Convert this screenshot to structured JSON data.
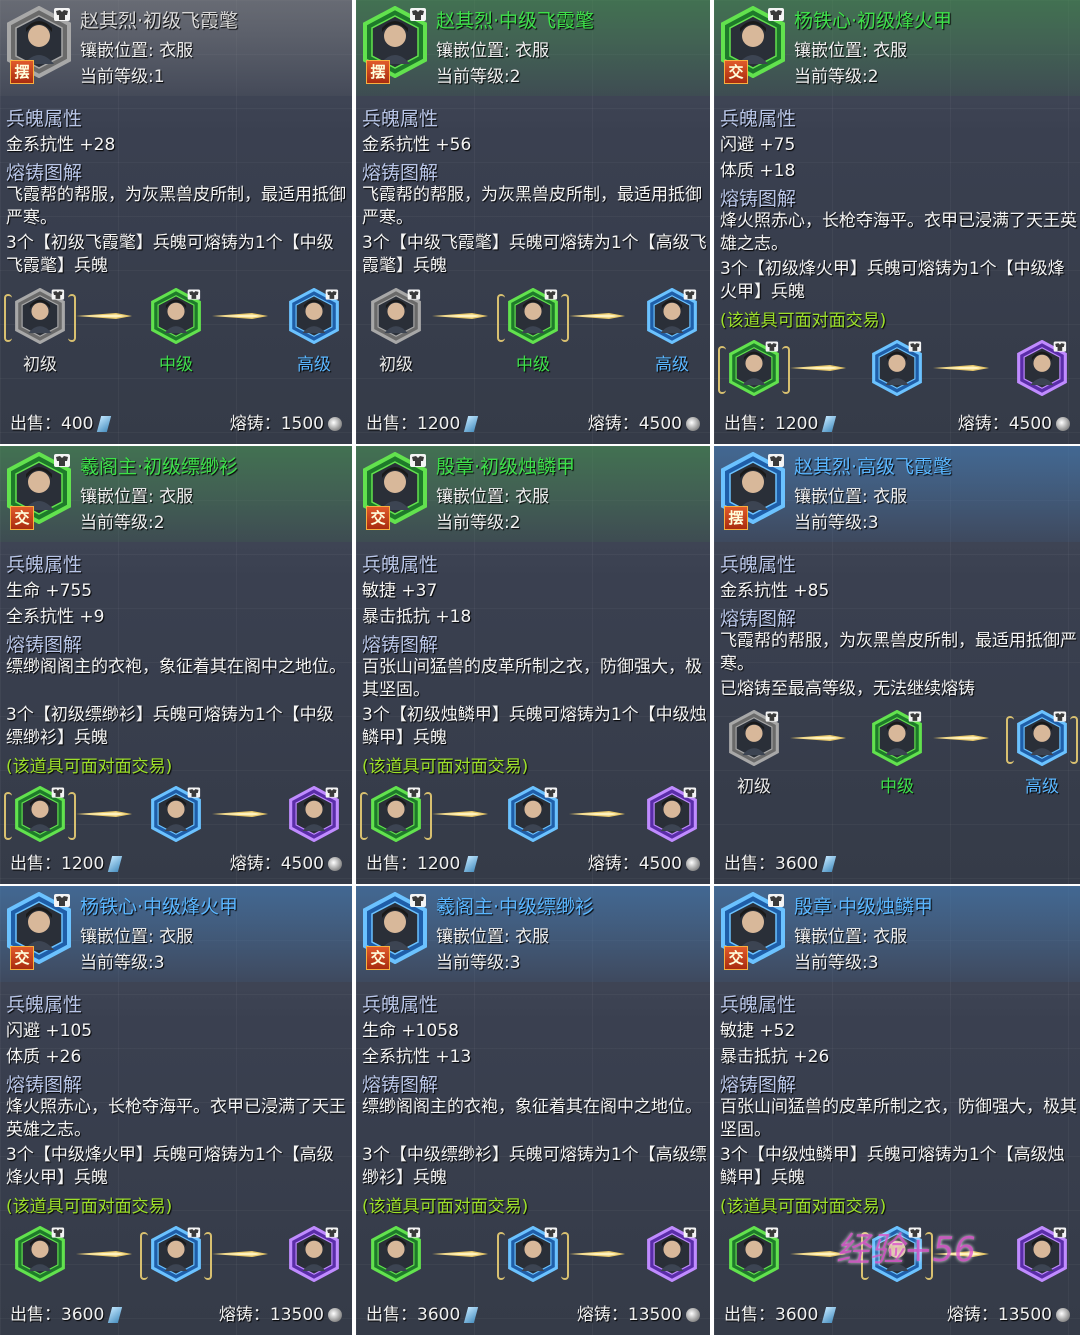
{
  "labels": {
    "slot_prefix": "镶嵌位置:",
    "level_prefix": "当前等级:",
    "attr_header": "兵魄属性",
    "forge_header": "熔铸图解",
    "tier_low": "初级",
    "tier_mid": "中级",
    "tier_high": "高级",
    "sell_prefix": "出售：",
    "forge_prefix": "熔铸：",
    "tradeable_note": "(该道具可面对面交易)"
  },
  "colors": {
    "tier_low": "#d8d8d8",
    "tier_mid": "#3ee04a",
    "tier_high": "#5ab6ff",
    "note": "#9de02a"
  },
  "cards": [
    {
      "badge": "摆",
      "title": "赵其烈·初级飞霞氅",
      "title_color": "gray",
      "slot": "衣服",
      "level": "1",
      "attrs": [
        "金系抗性 +28"
      ],
      "desc": "飞霞帮的帮服，为灰黑兽皮所制，最适用抵御严寒。",
      "forge_text": "3个【初级飞霞氅】兵魄可熔铸为1个【中级飞霞氅】兵魄",
      "note": "",
      "show_labels": true,
      "current": 0,
      "sell": "400",
      "forge": "1500"
    },
    {
      "badge": "摆",
      "title": "赵其烈·中级飞霞氅",
      "title_color": "green",
      "slot": "衣服",
      "level": "2",
      "attrs": [
        "金系抗性 +56"
      ],
      "desc": "飞霞帮的帮服，为灰黑兽皮所制，最适用抵御严寒。",
      "forge_text": "3个【中级飞霞氅】兵魄可熔铸为1个【高级飞霞氅】兵魄",
      "note": "",
      "show_labels": true,
      "current": 1,
      "sell": "1200",
      "forge": "4500"
    },
    {
      "badge": "交",
      "title": "杨铁心·初级烽火甲",
      "title_color": "green",
      "slot": "衣服",
      "level": "2",
      "attrs": [
        "闪避 +75",
        "体质 +18"
      ],
      "desc": "烽火照赤心，长枪夺海平。衣甲已浸满了天王英雄之志。",
      "forge_text": "3个【初级烽火甲】兵魄可熔铸为1个【中级烽火甲】兵魄",
      "note": "(该道具可面对面交易)",
      "show_labels": false,
      "current": 0,
      "sell": "1200",
      "forge": "4500"
    },
    {
      "badge": "交",
      "title": "羲阁主·初级缥缈衫",
      "title_color": "green",
      "slot": "衣服",
      "level": "2",
      "attrs": [
        "生命 +755",
        "全系抗性 +9"
      ],
      "desc": "缥缈阁阁主的衣袍，象征着其在阁中之地位。",
      "forge_text": "3个【初级缥缈衫】兵魄可熔铸为1个【中级缥缈衫】兵魄",
      "note": "(该道具可面对面交易)",
      "show_labels": false,
      "current": 0,
      "sell": "1200",
      "forge": "4500"
    },
    {
      "badge": "交",
      "title": "殷章·初级烛鳞甲",
      "title_color": "green",
      "slot": "衣服",
      "level": "2",
      "attrs": [
        "敏捷 +37",
        "暴击抵抗 +18"
      ],
      "desc": "百张山间猛兽的皮革所制之衣，防御强大，极其坚固。",
      "forge_text": "3个【初级烛鳞甲】兵魄可熔铸为1个【中级烛鳞甲】兵魄",
      "note": "(该道具可面对面交易)",
      "show_labels": false,
      "current": 0,
      "sell": "1200",
      "forge": "4500"
    },
    {
      "badge": "摆",
      "title": "赵其烈·高级飞霞氅",
      "title_color": "blue",
      "slot": "衣服",
      "level": "3",
      "attrs": [
        "金系抗性 +85"
      ],
      "desc": "飞霞帮的帮服，为灰黑兽皮所制，最适用抵御严寒。",
      "forge_text": "已熔铸至最高等级，无法继续熔铸",
      "note": "",
      "show_labels": true,
      "current": 2,
      "sell": "3600",
      "forge": ""
    },
    {
      "badge": "交",
      "title": "杨铁心·中级烽火甲",
      "title_color": "blue",
      "slot": "衣服",
      "level": "3",
      "attrs": [
        "闪避 +105",
        "体质 +26"
      ],
      "desc": "烽火照赤心，长枪夺海平。衣甲已浸满了天王英雄之志。",
      "forge_text": "3个【中级烽火甲】兵魄可熔铸为1个【高级烽火甲】兵魄",
      "note": "(该道具可面对面交易)",
      "show_labels": false,
      "current": 1,
      "sell": "3600",
      "forge": "13500"
    },
    {
      "badge": "交",
      "title": "羲阁主·中级缥缈衫",
      "title_color": "blue",
      "slot": "衣服",
      "level": "3",
      "attrs": [
        "生命 +1058",
        "全系抗性 +13"
      ],
      "desc": "缥缈阁阁主的衣袍，象征着其在阁中之地位。",
      "forge_text": "3个【中级缥缈衫】兵魄可熔铸为1个【高级缥缈衫】兵魄",
      "note": "(该道具可面对面交易)",
      "show_labels": false,
      "current": 1,
      "sell": "3600",
      "forge": "13500"
    },
    {
      "badge": "交",
      "title": "殷章·中级烛鳞甲",
      "title_color": "blue",
      "slot": "衣服",
      "level": "3",
      "attrs": [
        "敏捷 +52",
        "暴击抵抗 +26"
      ],
      "desc": "百张山间猛兽的皮革所制之衣，防御强大，极其坚固。",
      "forge_text": "3个【中级烛鳞甲】兵魄可熔铸为1个【高级烛鳞甲】兵魄",
      "note": "(该道具可面对面交易)",
      "show_labels": false,
      "current": 1,
      "sell": "3600",
      "forge": "13500"
    }
  ],
  "watermark": "经验+56"
}
